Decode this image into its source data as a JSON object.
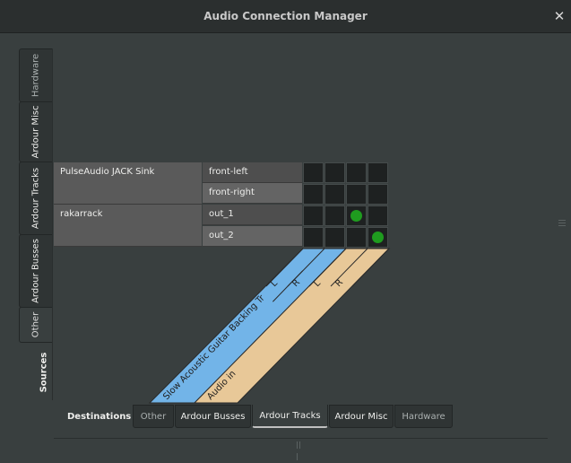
{
  "window": {
    "title": "Audio Connection Manager",
    "close_glyph": "✕"
  },
  "sources": {
    "label": "Sources",
    "tabs": [
      "Hardware",
      "Ardour Misc",
      "Ardour Tracks",
      "Ardour Busses",
      "Other"
    ],
    "active_tab": "Other",
    "bundles": [
      {
        "name": "PulseAudio JACK Sink",
        "ports": [
          "front-left",
          "front-right"
        ]
      },
      {
        "name": "rakarrack",
        "ports": [
          "out_1",
          "out_2"
        ]
      }
    ]
  },
  "destinations": {
    "label": "Destinations",
    "tabs": [
      "Other",
      "Ardour Busses",
      "Ardour Tracks",
      "Ardour Misc",
      "Hardware"
    ],
    "active_tab": "Ardour Tracks",
    "bundles": [
      {
        "name": "Slow Acoustic Guitar Backing Tr",
        "ports": [
          "L",
          "R"
        ],
        "color": "#72b4e8"
      },
      {
        "name": "Audio in",
        "ports": [
          "L",
          "R"
        ],
        "color": "#e8c898"
      }
    ]
  },
  "matrix": {
    "connections": [
      {
        "source": "out_1",
        "destination": "Audio in L"
      },
      {
        "source": "out_2",
        "destination": "Audio in R"
      }
    ],
    "connected_color": "#1f9c1f"
  }
}
